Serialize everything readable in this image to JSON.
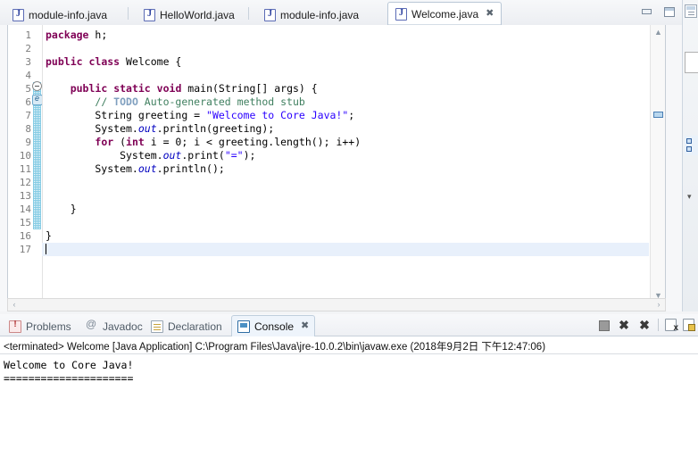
{
  "editor": {
    "tabs": [
      {
        "label": "module-info.java",
        "icon": "java-file-icon",
        "active": false,
        "closable": false
      },
      {
        "label": "HelloWorld.java",
        "icon": "java-file-icon",
        "active": false,
        "closable": false
      },
      {
        "label": "module-info.java",
        "icon": "java-file-icon",
        "active": false,
        "closable": false
      },
      {
        "label": "Welcome.java",
        "icon": "java-file-icon",
        "active": true,
        "closable": true,
        "close_glyph": "✖"
      }
    ],
    "window_buttons": [
      {
        "name": "minimize-editor-button",
        "label": "Minimize"
      },
      {
        "name": "maximize-editor-button",
        "label": "Maximize"
      }
    ],
    "line_numbers": [
      "1",
      "2",
      "3",
      "4",
      "5",
      "6",
      "7",
      "8",
      "9",
      "10",
      "11",
      "12",
      "13",
      "14",
      "15",
      "16",
      "17"
    ],
    "current_line": 17,
    "fold_marker_line": 5,
    "todo_marker_line": 6,
    "scroll": {
      "v_up_glyph": "▲",
      "v_down_glyph": "▼",
      "h_left_glyph": "‹",
      "h_right_glyph": "›"
    },
    "code_lines": [
      {
        "n": 1,
        "html": "<span class=\"kw\">package</span> h;"
      },
      {
        "n": 2,
        "html": ""
      },
      {
        "n": 3,
        "html": "<span class=\"kw\">public</span> <span class=\"kw\">class</span> Welcome {"
      },
      {
        "n": 4,
        "html": ""
      },
      {
        "n": 5,
        "html": "    <span class=\"kw\">public</span> <span class=\"kw\">static</span> <span class=\"kw\">void</span> main(String[] args) {"
      },
      {
        "n": 6,
        "html": "        <span class=\"cmt\">// </span><span class=\"tdo\">TODO</span><span class=\"cmt\"> Auto-generated method stub</span>"
      },
      {
        "n": 7,
        "html": "        String greeting = <span class=\"str\">\"Welcome to Core Java!\"</span>;"
      },
      {
        "n": 8,
        "html": "        System.<span class=\"fld\">out</span>.println(greeting);"
      },
      {
        "n": 9,
        "html": "        <span class=\"kw\">for</span> (<span class=\"kw\">int</span> i = 0; i &lt; greeting.length(); i++)"
      },
      {
        "n": 10,
        "html": "            System.<span class=\"fld\">out</span>.print(<span class=\"str\">\"=\"</span>);"
      },
      {
        "n": 11,
        "html": "        System.<span class=\"fld\">out</span>.println();"
      },
      {
        "n": 12,
        "html": ""
      },
      {
        "n": 13,
        "html": ""
      },
      {
        "n": 14,
        "html": "    }"
      },
      {
        "n": 15,
        "html": ""
      },
      {
        "n": 16,
        "html": "}"
      },
      {
        "n": 17,
        "html": "<span class=\"caret\"></span>"
      }
    ]
  },
  "right_strip": {
    "items": [
      {
        "name": "restore-perspective-button",
        "label": "Restore"
      },
      {
        "name": "outline-view-icon",
        "label": "Outline"
      },
      {
        "name": "package-explorer-icon",
        "label": "Package Explorer"
      }
    ]
  },
  "bottom_panel": {
    "tabs": [
      {
        "label": "Problems",
        "icon": "problems-icon",
        "active": false,
        "closable": false
      },
      {
        "label": "Javadoc",
        "icon": "javadoc-icon",
        "active": false,
        "closable": false
      },
      {
        "label": "Declaration",
        "icon": "declaration-icon",
        "active": false,
        "closable": false
      },
      {
        "label": "Console",
        "icon": "console-icon",
        "active": true,
        "closable": true,
        "close_glyph": "✖"
      }
    ],
    "toolbar": [
      {
        "name": "terminate-button",
        "label": "Terminate"
      },
      {
        "name": "remove-launch-button",
        "label": "Remove Launch"
      },
      {
        "name": "remove-all-terminated-button",
        "label": "Remove All Terminated Launches"
      },
      {
        "name": "clear-console-button",
        "label": "Clear Console"
      },
      {
        "name": "scroll-lock-button",
        "label": "Scroll Lock"
      }
    ],
    "console": {
      "header": "<terminated> Welcome [Java Application] C:\\Program Files\\Java\\jre-10.0.2\\bin\\javaw.exe (2018年9月2日 下午12:47:06)",
      "output": "Welcome to Core Java!\n====================="
    }
  },
  "colors": {
    "keyword": "#7f0055",
    "string": "#2a00ff",
    "comment": "#3f7f5f",
    "todo": "#7f9fbf",
    "field": "#0000c0",
    "current_line_highlight": "#e8f0fb",
    "tab_active_bg": "#ffffff",
    "bottom_tab_active_bg": "#eef4fb",
    "fold_stripe": "#6fc3e0"
  }
}
